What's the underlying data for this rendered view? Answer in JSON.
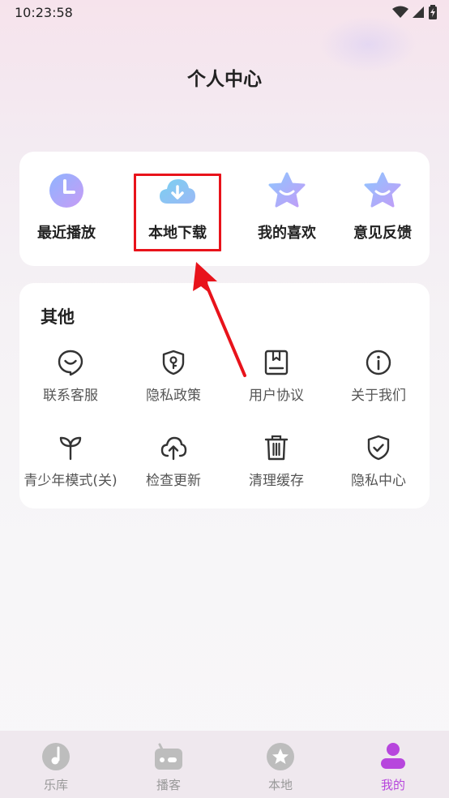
{
  "status_bar": {
    "time": "10:23:58"
  },
  "header": {
    "title": "个人中心"
  },
  "quick_actions": [
    {
      "label": "最近播放",
      "icon": "clock-icon"
    },
    {
      "label": "本地下载",
      "icon": "cloud-download-icon"
    },
    {
      "label": "我的喜欢",
      "icon": "star-icon"
    },
    {
      "label": "意见反馈",
      "icon": "star-icon"
    }
  ],
  "others": {
    "title": "其他",
    "items": [
      {
        "label": "联系客服",
        "icon": "customer-service-icon"
      },
      {
        "label": "隐私政策",
        "icon": "shield-key-icon"
      },
      {
        "label": "用户协议",
        "icon": "book-icon"
      },
      {
        "label": "关于我们",
        "icon": "info-icon"
      },
      {
        "label": "青少年模式(关)",
        "icon": "sprout-icon"
      },
      {
        "label": "检查更新",
        "icon": "cloud-upload-icon"
      },
      {
        "label": "清理缓存",
        "icon": "trash-icon"
      },
      {
        "label": "隐私中心",
        "icon": "shield-check-icon"
      }
    ]
  },
  "bottom_nav": [
    {
      "label": "乐库",
      "icon": "music-disc-icon",
      "active": false
    },
    {
      "label": "播客",
      "icon": "radio-icon",
      "active": false
    },
    {
      "label": "本地",
      "icon": "star-circle-icon",
      "active": false
    },
    {
      "label": "我的",
      "icon": "user-icon",
      "active": true
    }
  ],
  "colors": {
    "accent": "#b746dd",
    "highlight": "#e8131b",
    "icon_gradient_start": "#8fb4ff",
    "icon_gradient_end": "#c79cf5"
  }
}
